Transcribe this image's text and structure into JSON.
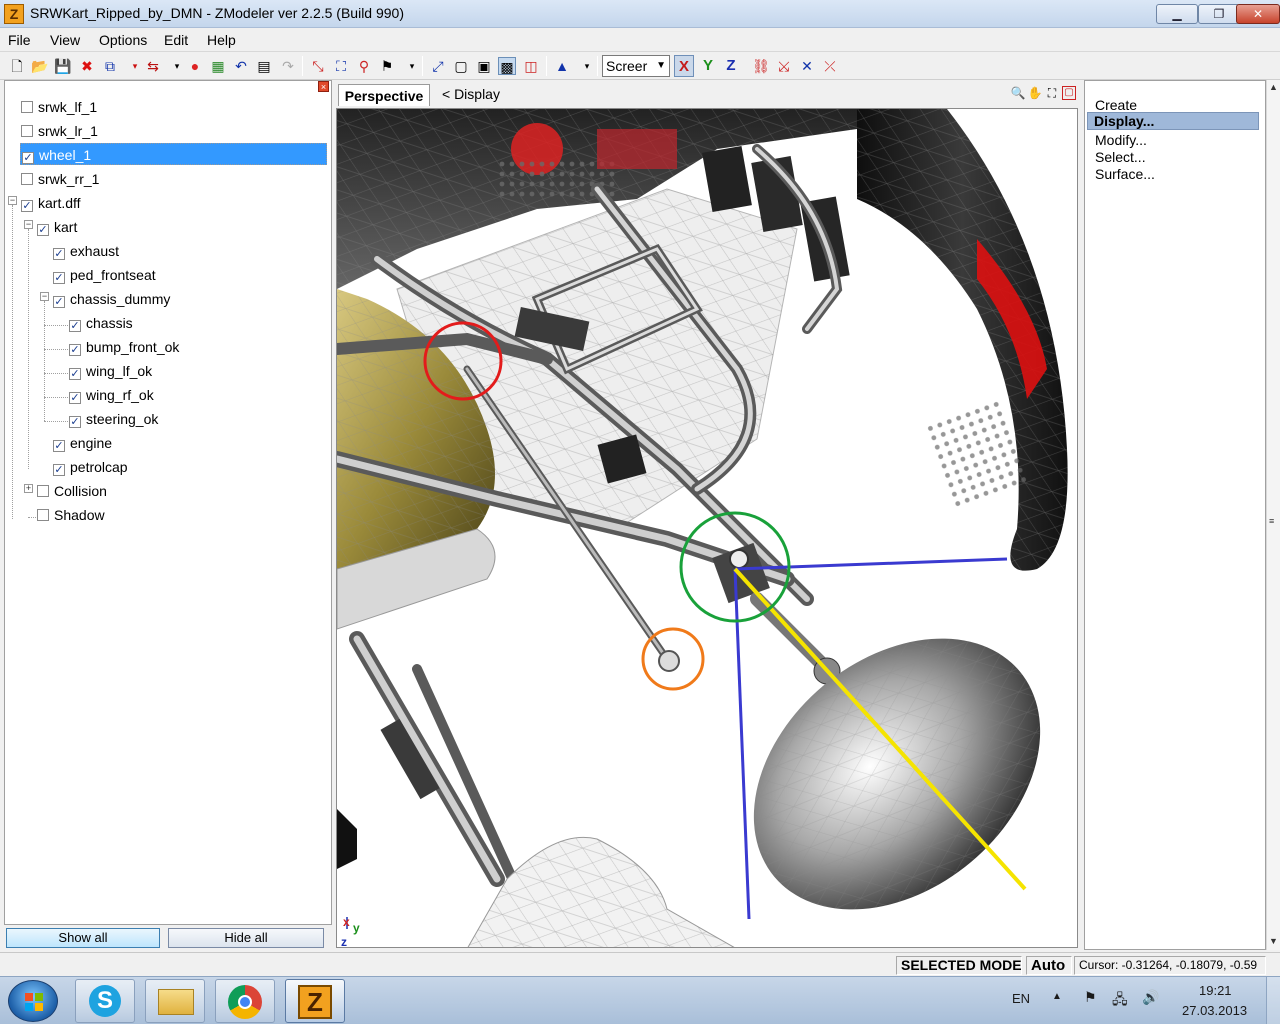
{
  "window": {
    "title": "SRWKart_Ripped_by_DMN - ZModeler ver 2.2.5 (Build 990)",
    "app_icon_letter": "Z",
    "min_label": "▁",
    "max_label": "❐",
    "close_label": "✕"
  },
  "menu": [
    "File",
    "View",
    "Options",
    "Edit",
    "Help"
  ],
  "toolbar": {
    "screen_select": "Screer",
    "axis_x": "X",
    "axis_y": "Y",
    "axis_z": "Z"
  },
  "tree": {
    "items": [
      {
        "label": "srwk_lf_1",
        "checked": false,
        "selected": false
      },
      {
        "label": "srwk_lr_1",
        "checked": false,
        "selected": false
      },
      {
        "label": "wheel_1",
        "checked": true,
        "selected": true
      },
      {
        "label": "srwk_rr_1",
        "checked": false,
        "selected": false
      },
      {
        "label": "kart.dff",
        "checked": true,
        "selected": false
      },
      {
        "label": "kart",
        "checked": true,
        "selected": false
      },
      {
        "label": "exhaust",
        "checked": true,
        "selected": false
      },
      {
        "label": "ped_frontseat",
        "checked": true,
        "selected": false
      },
      {
        "label": "chassis_dummy",
        "checked": true,
        "selected": false
      },
      {
        "label": "chassis",
        "checked": true,
        "selected": false
      },
      {
        "label": "bump_front_ok",
        "checked": true,
        "selected": false
      },
      {
        "label": "wing_lf_ok",
        "checked": true,
        "selected": false
      },
      {
        "label": "wing_rf_ok",
        "checked": true,
        "selected": false
      },
      {
        "label": "steering_ok",
        "checked": true,
        "selected": false
      },
      {
        "label": "engine",
        "checked": true,
        "selected": false
      },
      {
        "label": "petrolcap",
        "checked": true,
        "selected": false
      },
      {
        "label": "Collision",
        "checked": false,
        "selected": false
      },
      {
        "label": "Shadow",
        "checked": false,
        "selected": false
      }
    ],
    "show_all": "Show all",
    "hide_all": "Hide all"
  },
  "viewport": {
    "tab": "Perspective",
    "display_nav": "<  Display",
    "axis_labels": [
      "x",
      "y",
      "z"
    ]
  },
  "commands": {
    "items": [
      "Create",
      "Display...",
      "Modify...",
      "Select...",
      "Surface..."
    ],
    "selected_index": 1
  },
  "status": {
    "mode": "SELECTED MODE",
    "auto": "Auto",
    "cursor": "Cursor: -0.31264, -0.18079, -0.59"
  },
  "taskbar": {
    "lang": "EN",
    "time": "19:21",
    "date": "27.03.2013"
  },
  "colors": {
    "selection": "#3399ff",
    "annotation_red": "#e31b1b",
    "annotation_green": "#19a13a",
    "annotation_orange": "#f07a1a",
    "axis_blue": "#3a3ad0",
    "axis_yellow": "#f5e400"
  }
}
